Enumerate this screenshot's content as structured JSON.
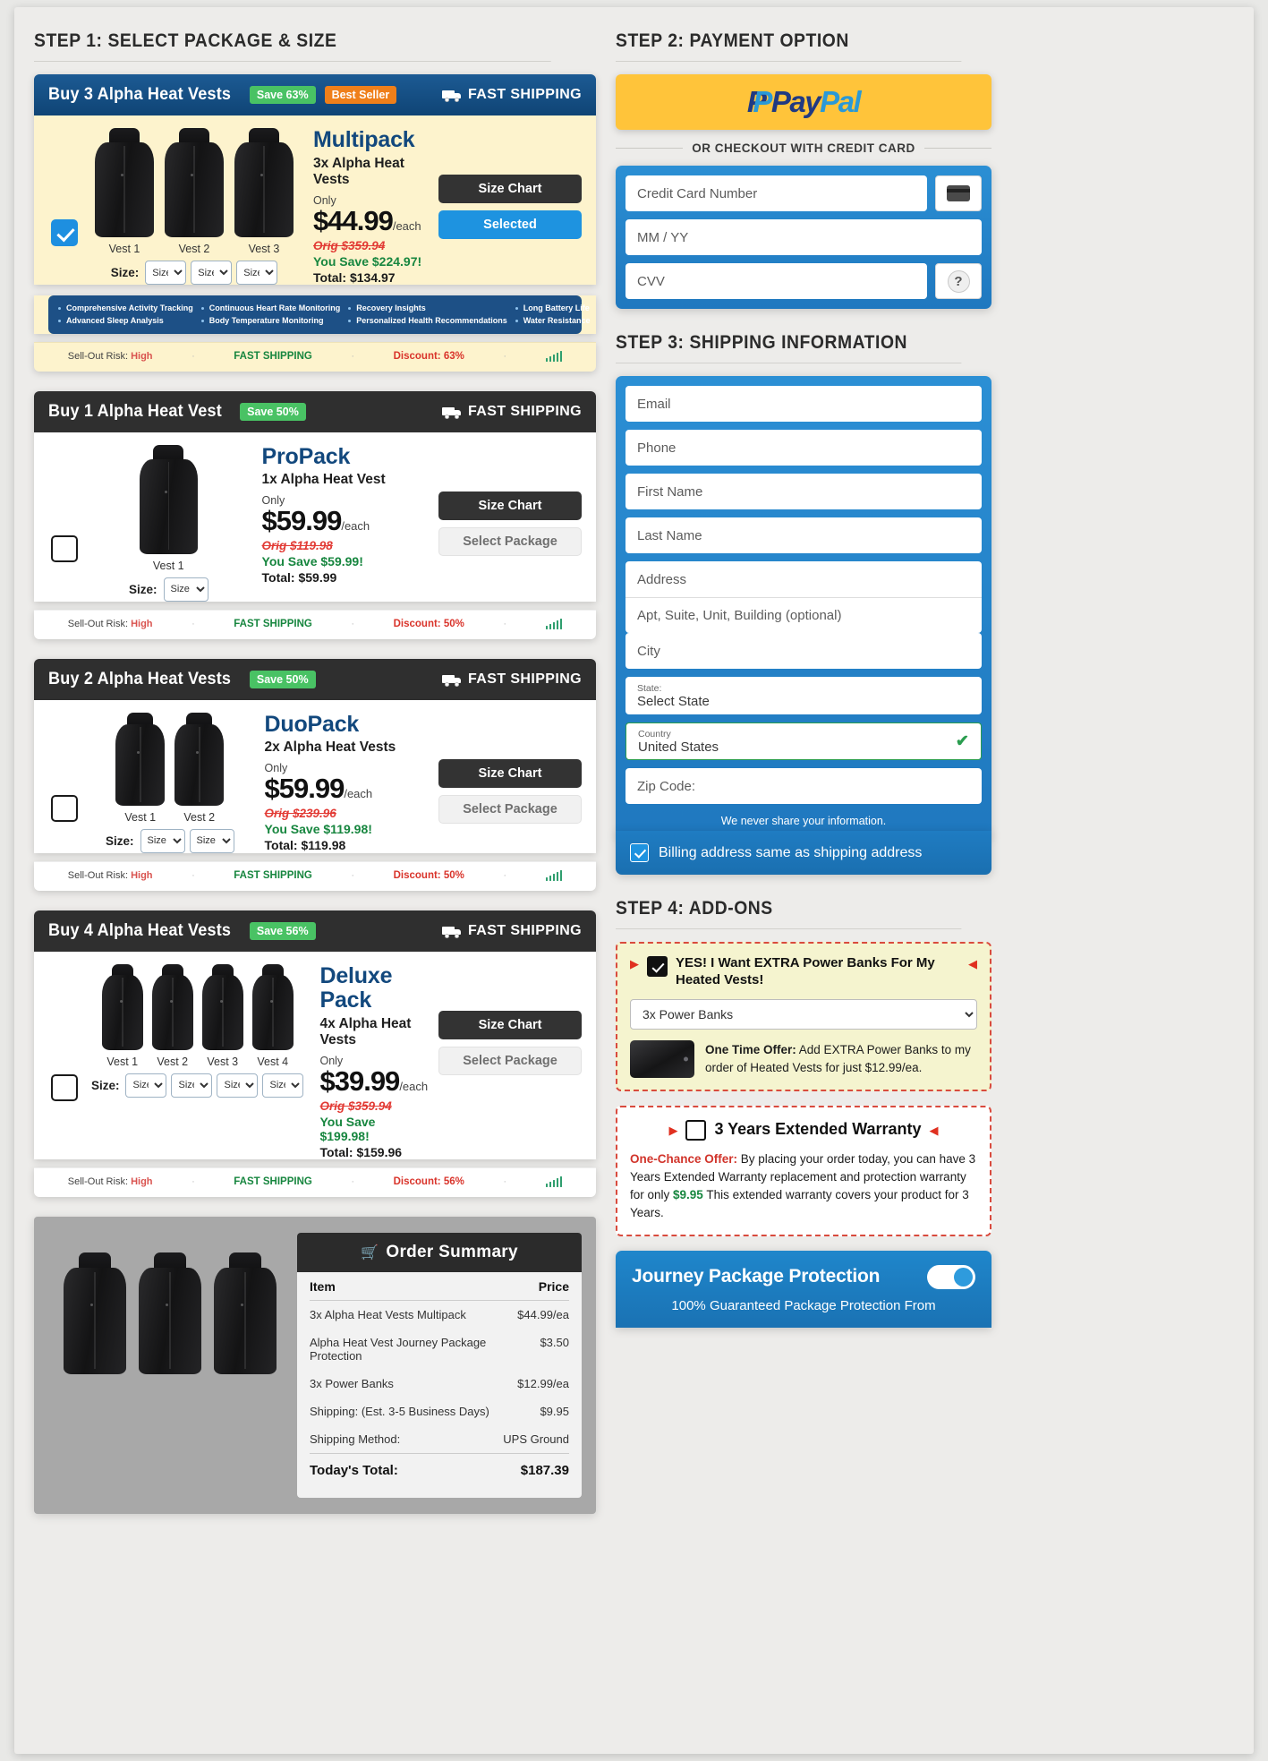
{
  "steps": {
    "step1": "STEP 1: SELECT PACKAGE & SIZE",
    "step2": "STEP 2: PAYMENT OPTION",
    "step3": "STEP 3: SHIPPING INFORMATION",
    "step4": "STEP 4: ADD-ONS"
  },
  "fast_shipping": "FAST SHIPPING",
  "size_label": "Size:",
  "size_placeholder": "Size",
  "packages": [
    {
      "header": "Buy 3 Alpha Heat Vests",
      "save_badge": "Save 63%",
      "seller_badge": "Best Seller",
      "name": "Multipack",
      "subtitle": "3x Alpha Heat Vests",
      "only": "Only",
      "price": "$44.99",
      "each": "/each",
      "orig": "Orig $359.94",
      "save": "You Save $224.97!",
      "total": "Total: $134.97",
      "size_chart": "Size Chart",
      "action": "Selected",
      "selected": true,
      "vest_count": 3,
      "vest_labels": [
        "Vest 1",
        "Vest 2",
        "Vest 3"
      ],
      "status": {
        "risk_label": "Sell-Out Risk:",
        "risk_value": "High",
        "shipping": "FAST SHIPPING",
        "discount": "Discount: 63%"
      },
      "features": [
        [
          "Comprehensive Activity Tracking",
          "Advanced Sleep Analysis"
        ],
        [
          "Continuous Heart Rate Monitoring",
          "Body Temperature Monitoring"
        ],
        [
          "Recovery Insights",
          "Personalized Health Recommendations"
        ],
        [
          "Long Battery Life",
          "Water Resistance"
        ]
      ]
    },
    {
      "header": "Buy 1 Alpha Heat Vest",
      "save_badge": "Save 50%",
      "name": "ProPack",
      "subtitle": "1x Alpha Heat Vest",
      "only": "Only",
      "price": "$59.99",
      "each": "/each",
      "orig": "Orig $119.98",
      "save": "You Save $59.99!",
      "total": "Total: $59.99",
      "size_chart": "Size Chart",
      "action": "Select Package",
      "selected": false,
      "vest_count": 1,
      "vest_labels": [
        "Vest 1"
      ],
      "status": {
        "risk_label": "Sell-Out Risk:",
        "risk_value": "High",
        "shipping": "FAST SHIPPING",
        "discount": "Discount: 50%"
      }
    },
    {
      "header": "Buy 2 Alpha Heat Vests",
      "save_badge": "Save 50%",
      "name": "DuoPack",
      "subtitle": "2x Alpha Heat Vests",
      "only": "Only",
      "price": "$59.99",
      "each": "/each",
      "orig": "Orig $239.96",
      "save": "You Save $119.98!",
      "total": "Total: $119.98",
      "size_chart": "Size Chart",
      "action": "Select Package",
      "selected": false,
      "vest_count": 2,
      "vest_labels": [
        "Vest 1",
        "Vest 2"
      ],
      "status": {
        "risk_label": "Sell-Out Risk:",
        "risk_value": "High",
        "shipping": "FAST SHIPPING",
        "discount": "Discount: 50%"
      }
    },
    {
      "header": "Buy 4 Alpha Heat Vests",
      "save_badge": "Save 56%",
      "name": "Deluxe Pack",
      "subtitle": "4x Alpha Heat Vests",
      "only": "Only",
      "price": "$39.99",
      "each": "/each",
      "orig": "Orig $359.94",
      "save": "You Save $199.98!",
      "total": "Total: $159.96",
      "size_chart": "Size Chart",
      "action": "Select Package",
      "selected": false,
      "vest_count": 4,
      "vest_labels": [
        "Vest 1",
        "Vest 2",
        "Vest 3",
        "Vest 4"
      ],
      "status": {
        "risk_label": "Sell-Out Risk:",
        "risk_value": "High",
        "shipping": "FAST SHIPPING",
        "discount": "Discount: 56%"
      }
    }
  ],
  "order_summary": {
    "title": "Order Summary",
    "cart_icon": "cart-icon",
    "col_item": "Item",
    "col_price": "Price",
    "rows": [
      {
        "item": "3x Alpha Heat Vests Multipack",
        "price": "$44.99/ea"
      },
      {
        "item": "Alpha Heat Vest Journey Package Protection",
        "price": "$3.50"
      },
      {
        "item": "3x Power Banks",
        "price": "$12.99/ea"
      },
      {
        "item": "Shipping: (Est. 3-5 Business Days)",
        "price": "$9.95"
      },
      {
        "item": "Shipping Method:",
        "price": "UPS Ground"
      }
    ],
    "total_label": "Today's Total:",
    "total_value": "$187.39"
  },
  "payment": {
    "paypal_p": "P",
    "paypal_pay": "Pay",
    "paypal_pal": "Pal",
    "or_text": "OR CHECKOUT WITH CREDIT CARD",
    "card_number": "Credit Card Number",
    "expiry": "MM / YY",
    "cvv": "CVV",
    "help_glyph": "?"
  },
  "shipping": {
    "email": "Email",
    "phone": "Phone",
    "first_name": "First Name",
    "last_name": "Last Name",
    "address": "Address",
    "apt": "Apt, Suite, Unit, Building (optional)",
    "city": "City",
    "state_label": "State:",
    "state_value": "Select State",
    "country_label": "Country",
    "country_value": "United States",
    "zip": "Zip Code:",
    "privacy": "We never share your information.",
    "billing_same": "Billing address same as shipping address"
  },
  "addons": {
    "power_banks": {
      "title": "YES! I Want EXTRA Power Banks For My Heated Vests!",
      "select_value": "3x Power Banks",
      "offer_label": "One Time Offer:",
      "offer_text": " Add EXTRA Power Banks to my order of Heated Vests for just $12.99/ea."
    },
    "warranty": {
      "title": "3 Years Extended Warranty",
      "once_label": "One-Chance Offer:",
      "body_1": " By placing your order today, you can have 3 Years Extended Warranty replacement and protection warranty for only ",
      "amount": "$9.95",
      "body_2": " This extended warranty covers your product for 3 Years."
    },
    "jpp": {
      "title": "Journey Package Protection",
      "subtitle": "100% Guaranteed Package Protection From"
    }
  }
}
